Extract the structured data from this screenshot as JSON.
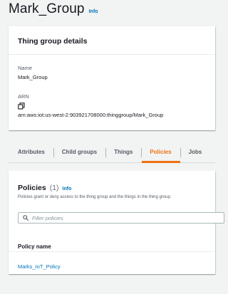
{
  "header": {
    "title": "Mark_Group",
    "info_label": "Info"
  },
  "details": {
    "title": "Thing group details",
    "name_label": "Name",
    "name_value": "Mark_Group",
    "arn_label": "ARN",
    "arn_value": "arn:aws:iot:us-west-2:903921708000:thinggroup/Mark_Group",
    "copy_icon": "copy-icon"
  },
  "tabs": [
    {
      "label": "Attributes",
      "active": false
    },
    {
      "label": "Child groups",
      "active": false
    },
    {
      "label": "Things",
      "active": false
    },
    {
      "label": "Policies",
      "active": true
    },
    {
      "label": "Jobs",
      "active": false
    }
  ],
  "policies": {
    "title": "Policies",
    "count": "(1)",
    "info_label": "Info",
    "description": "Policies grant or deny access to the thing group and the things in the thing group.",
    "search_placeholder": "Filter policies",
    "search_icon": "search-icon",
    "column_header": "Policy name",
    "rows": [
      {
        "name": "Marks_IoT_Policy"
      }
    ]
  },
  "colors": {
    "accent": "#ec7211",
    "link": "#0073bb",
    "background": "#f2f3f3"
  }
}
